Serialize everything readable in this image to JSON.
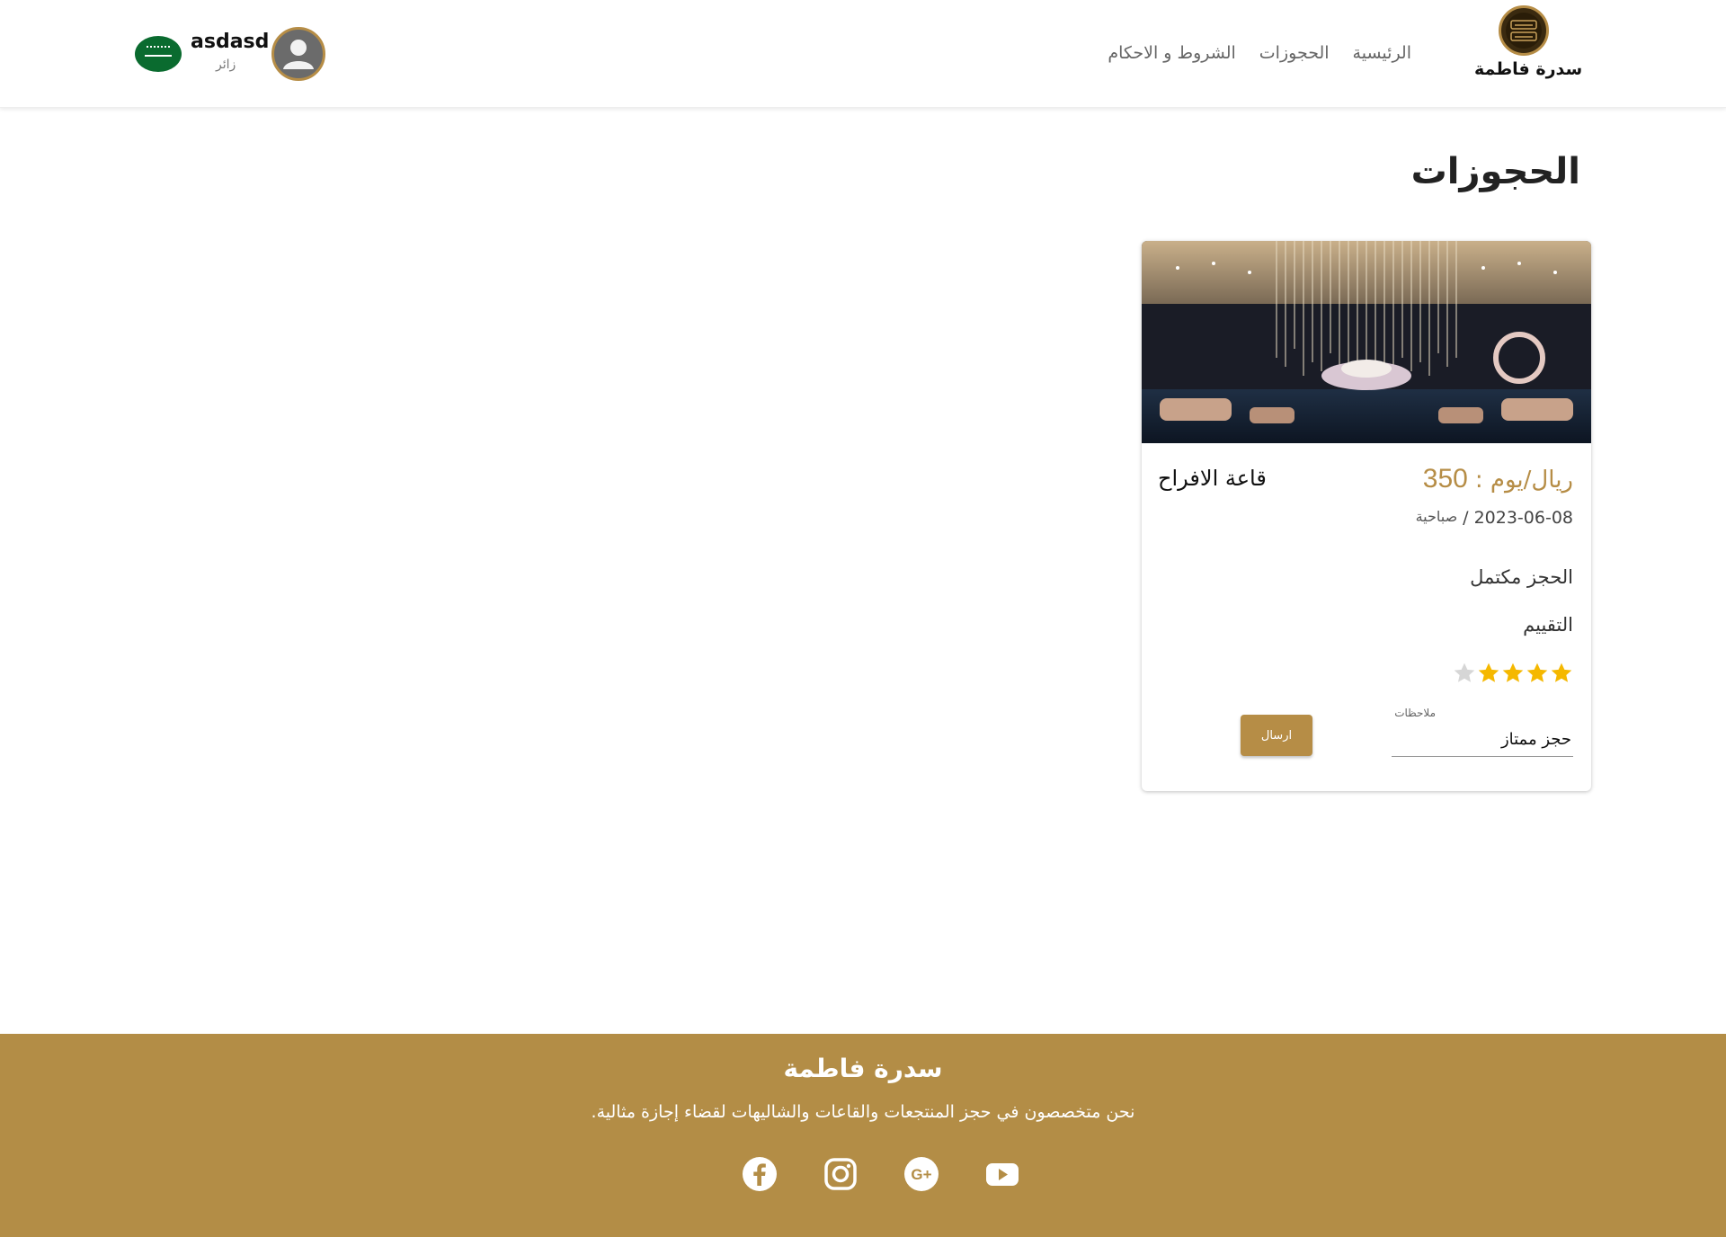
{
  "brand": {
    "name": "سدرة فاطمة",
    "logo_text": "سدرة فاطمة"
  },
  "nav": {
    "items": [
      {
        "label": "الرئيسية"
      },
      {
        "label": "الحجوزات"
      },
      {
        "label": "الشروط و الاحكام"
      }
    ]
  },
  "user": {
    "name": "asdasd",
    "role": "زائر",
    "flag_icon": "saudi-flag-icon",
    "avatar_icon": "user-avatar-icon"
  },
  "page": {
    "title": "الحجوزات"
  },
  "booking": {
    "price_unit": ": ريال/يوم",
    "price_value": "350",
    "hall_name": "قاعة الافراح",
    "date": "2023-06-08",
    "date_separator": "/",
    "period": "صباحية",
    "status": "الحجز مكتمل",
    "rating_label": "التقييم",
    "rating": 4,
    "rating_max": 5,
    "notes_label": "ملاحظات",
    "notes_value": "حجز ممتاز",
    "send_label": "ارسال"
  },
  "footer": {
    "title": "سدرة فاطمة",
    "text": ".نحن متخصصون في حجز المنتجعات والقاعات والشاليهات لقضاء إجازة مثالية",
    "socials": [
      "facebook-icon",
      "instagram-icon",
      "google-plus-icon",
      "youtube-icon"
    ]
  },
  "colors": {
    "accent": "#b68d46",
    "star_filled": "#f5b800",
    "star_empty": "#d6d6d6"
  }
}
